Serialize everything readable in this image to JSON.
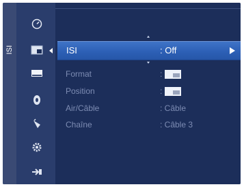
{
  "side_label": "ISI",
  "colors": {
    "panel_bg": "#1c2e5a",
    "highlight": "#2d60b6",
    "dim_text": "#7d8cb3"
  },
  "icons": [
    {
      "name": "clock-icon"
    },
    {
      "name": "pip-icon"
    },
    {
      "name": "picture-icon"
    },
    {
      "name": "sound-icon"
    },
    {
      "name": "channel-icon"
    },
    {
      "name": "setup-icon"
    },
    {
      "name": "input-icon"
    }
  ],
  "selected": {
    "label": "ISI",
    "value": ": Off"
  },
  "rows": [
    {
      "label": "Format",
      "value": ":",
      "has_pic": true
    },
    {
      "label": "Position",
      "value": ":",
      "has_pic": true
    },
    {
      "label": "Air/Câble",
      "value": ": Câble",
      "has_pic": false
    },
    {
      "label": "Chaîne",
      "value": ": Câble 3",
      "has_pic": false
    }
  ]
}
